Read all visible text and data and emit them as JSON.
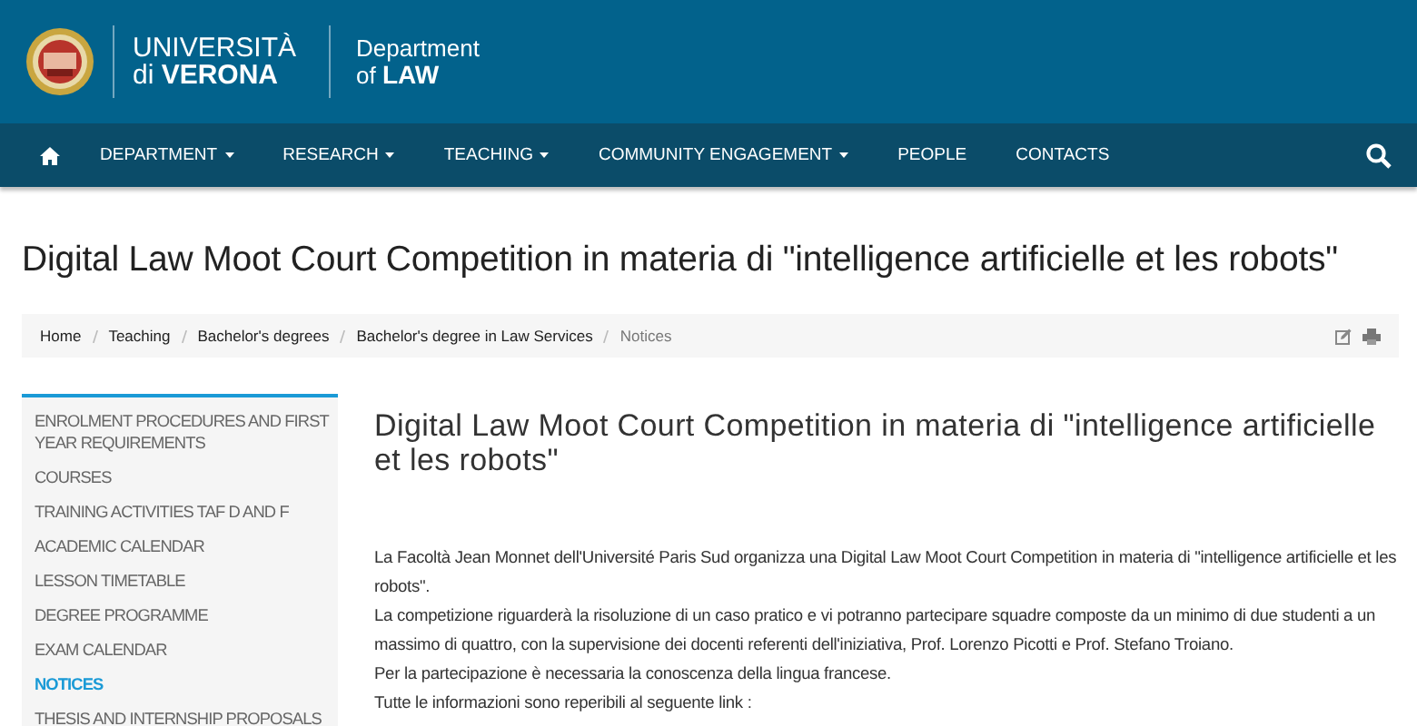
{
  "header": {
    "university_line1": "UNIVERSITÀ",
    "university_line2_prefix": "di",
    "university_line2_bold": "VERONA",
    "department_line1": "Department",
    "department_line2_prefix": "of",
    "department_line2_bold": "LAW"
  },
  "nav": {
    "items": [
      {
        "label": "DEPARTMENT",
        "dropdown": true
      },
      {
        "label": "RESEARCH",
        "dropdown": true
      },
      {
        "label": "TEACHING",
        "dropdown": true
      },
      {
        "label": "COMMUNITY ENGAGEMENT",
        "dropdown": true
      },
      {
        "label": "PEOPLE",
        "dropdown": false
      },
      {
        "label": "CONTACTS",
        "dropdown": false
      }
    ]
  },
  "page_title": "Digital Law Moot Court Competition in materia di \"intelligence artificielle et les robots\"",
  "breadcrumb": [
    "Home",
    "Teaching",
    "Bachelor's degrees",
    "Bachelor's degree in Law Services",
    "Notices"
  ],
  "sidebar": {
    "items": [
      {
        "label": "ENROLMENT PROCEDURES AND FIRST YEAR REQUIREMENTS",
        "selected": false
      },
      {
        "label": "COURSES",
        "selected": false
      },
      {
        "label": "TRAINING ACTIVITIES TAF D AND F",
        "selected": false
      },
      {
        "label": "ACADEMIC CALENDAR",
        "selected": false
      },
      {
        "label": "LESSON TIMETABLE",
        "selected": false
      },
      {
        "label": "DEGREE PROGRAMME",
        "selected": false
      },
      {
        "label": "EXAM CALENDAR",
        "selected": false
      },
      {
        "label": "NOTICES",
        "selected": true
      },
      {
        "label": "THESIS AND INTERNSHIP PROPOSALS",
        "selected": false
      }
    ]
  },
  "article": {
    "title": "Digital Law Moot Court Competition in materia di \"intelligence artificielle et les robots\"",
    "paragraphs": [
      "La Facoltà Jean Monnet dell'Université Paris Sud organizza una Digital Law Moot Court Competition in materia di \"intelligence artificielle et les robots\".",
      "La competizione riguarderà la risoluzione di un caso pratico e vi potranno partecipare squadre composte da un minimo di due studenti a un massimo di quattro, con la supervisione dei docenti referenti dell'iniziativa, Prof. Lorenzo Picotti e Prof. Stefano Troiano.",
      "Per la partecipazione è necessaria la conoscenza della lingua francese.",
      "Tutte le informazioni sono reperibili al seguente link :"
    ]
  }
}
